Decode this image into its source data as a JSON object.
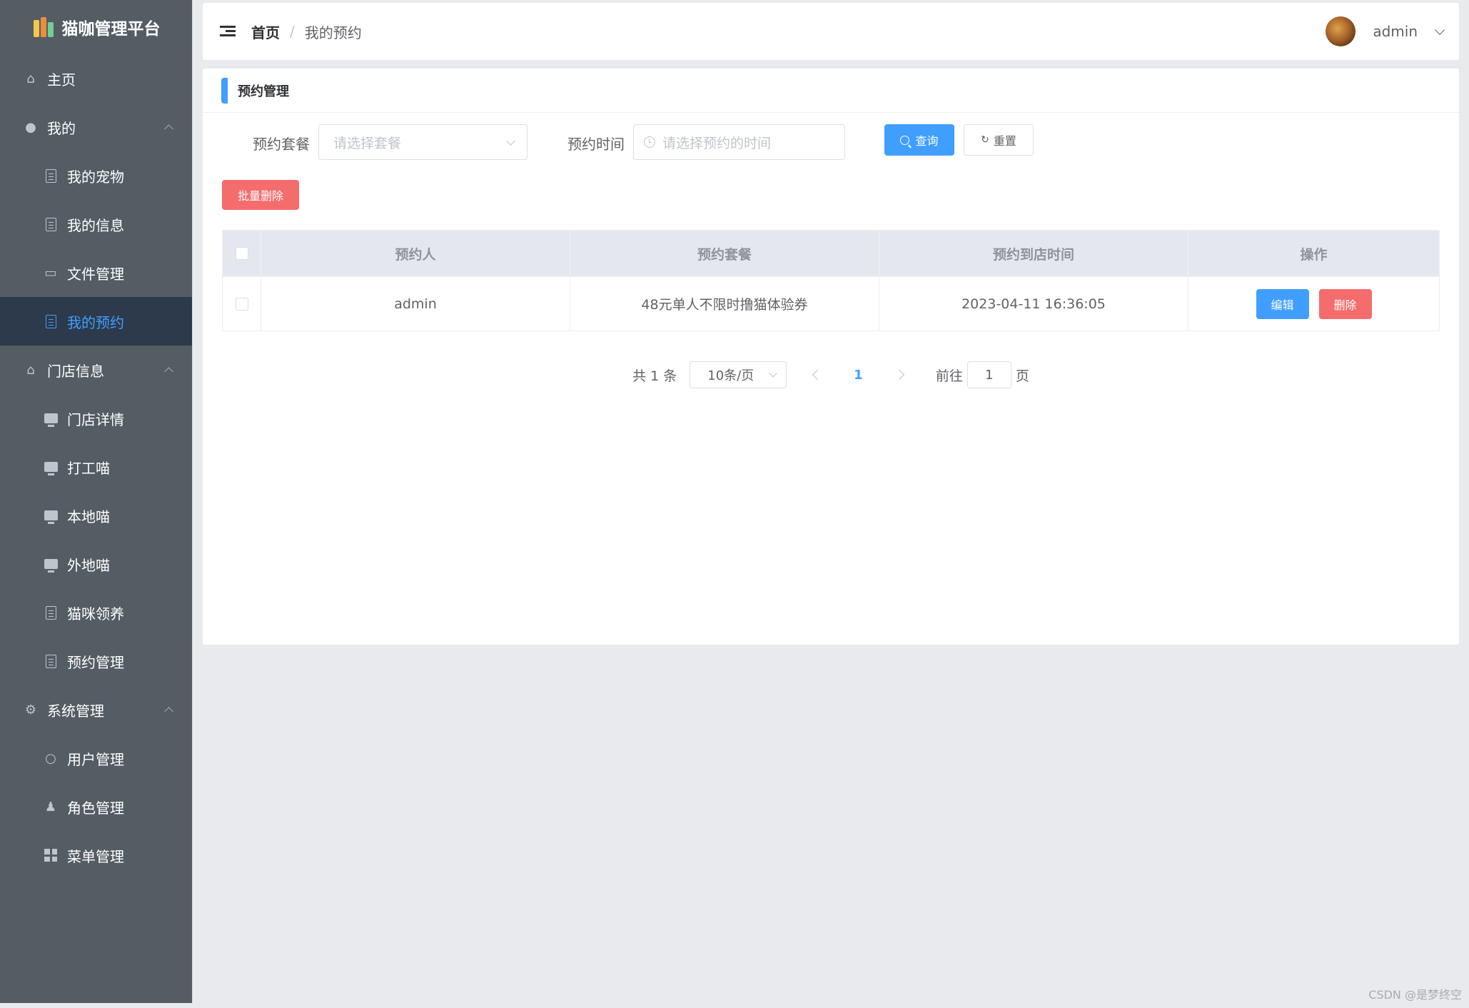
{
  "app": {
    "title": "猫咖管理平台"
  },
  "sidebar": {
    "items": [
      {
        "label": "主页",
        "level": "top",
        "icon": "home-icon"
      },
      {
        "label": "我的",
        "level": "top",
        "icon": "user-icon",
        "expanded": true
      },
      {
        "label": "我的宠物",
        "level": "sub",
        "icon": "pet-icon"
      },
      {
        "label": "我的信息",
        "level": "sub",
        "icon": "document-icon"
      },
      {
        "label": "文件管理",
        "level": "sub",
        "icon": "folder-icon"
      },
      {
        "label": "我的预约",
        "level": "sub",
        "icon": "document-icon",
        "active": true
      },
      {
        "label": "门店信息",
        "level": "top",
        "icon": "house-icon",
        "expanded": true
      },
      {
        "label": "门店详情",
        "level": "sub",
        "icon": "monitor-icon"
      },
      {
        "label": "打工喵",
        "level": "sub",
        "icon": "monitor-icon"
      },
      {
        "label": "本地喵",
        "level": "sub",
        "icon": "monitor-icon"
      },
      {
        "label": "外地喵",
        "level": "sub",
        "icon": "monitor-icon"
      },
      {
        "label": "猫咪领养",
        "level": "sub",
        "icon": "document-icon"
      },
      {
        "label": "预约管理",
        "level": "sub",
        "icon": "document-icon"
      },
      {
        "label": "系统管理",
        "level": "top",
        "icon": "gear-icon",
        "expanded": true
      },
      {
        "label": "用户管理",
        "level": "sub",
        "icon": "user-outline-icon"
      },
      {
        "label": "角色管理",
        "level": "sub",
        "icon": "stamp-icon"
      },
      {
        "label": "菜单管理",
        "level": "sub",
        "icon": "grid-icon"
      }
    ]
  },
  "header": {
    "breadcrumb_home": "首页",
    "breadcrumb_sep": "/",
    "breadcrumb_current": "我的预约",
    "username": "admin"
  },
  "panel": {
    "title": "预约管理",
    "filters": {
      "package_label": "预约套餐",
      "package_placeholder": "请选择套餐",
      "time_label": "预约时间",
      "time_placeholder": "请选择预约的时间",
      "search_label": "查询",
      "reset_label": "重置"
    },
    "batch_delete_label": "批量删除",
    "table": {
      "headers": [
        "预约人",
        "预约套餐",
        "预约到店时间",
        "操作"
      ],
      "rows": [
        {
          "person": "admin",
          "package": "48元单人不限时撸猫体验券",
          "time": "2023-04-11 16:36:05",
          "edit_label": "编辑",
          "delete_label": "删除"
        }
      ]
    },
    "pagination": {
      "total_text": "共 1 条",
      "page_size": "10条/页",
      "current_page": "1",
      "goto_prefix": "前往",
      "goto_value": "1",
      "goto_suffix": "页"
    }
  },
  "watermark": "CSDN @是梦终空",
  "colors": {
    "sidebar_bg": "#545c64",
    "active_bg": "#2d3a4b",
    "primary": "#409eff",
    "danger": "#f56c6c"
  }
}
